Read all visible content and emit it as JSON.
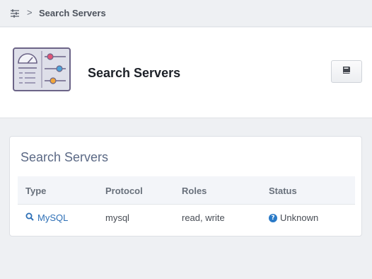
{
  "breadcrumb": {
    "separator": ">",
    "current": "Search Servers"
  },
  "header": {
    "title": "Search Servers"
  },
  "servers_card": {
    "title": "Search Servers",
    "columns": [
      "Type",
      "Protocol",
      "Roles",
      "Status"
    ],
    "rows": [
      {
        "type": "MySQL",
        "protocol": "mysql",
        "roles": "read, write",
        "status": "Unknown"
      }
    ]
  },
  "colors": {
    "accent": "#2d6fb6",
    "status_unknown": "#2a7ac7",
    "card_title": "#5b6985"
  },
  "icons": {
    "breadcrumb": "sliders-icon",
    "app": "server-config-illustration",
    "docs": "book-icon",
    "type": "search-icon",
    "status": "question-circle-icon"
  }
}
